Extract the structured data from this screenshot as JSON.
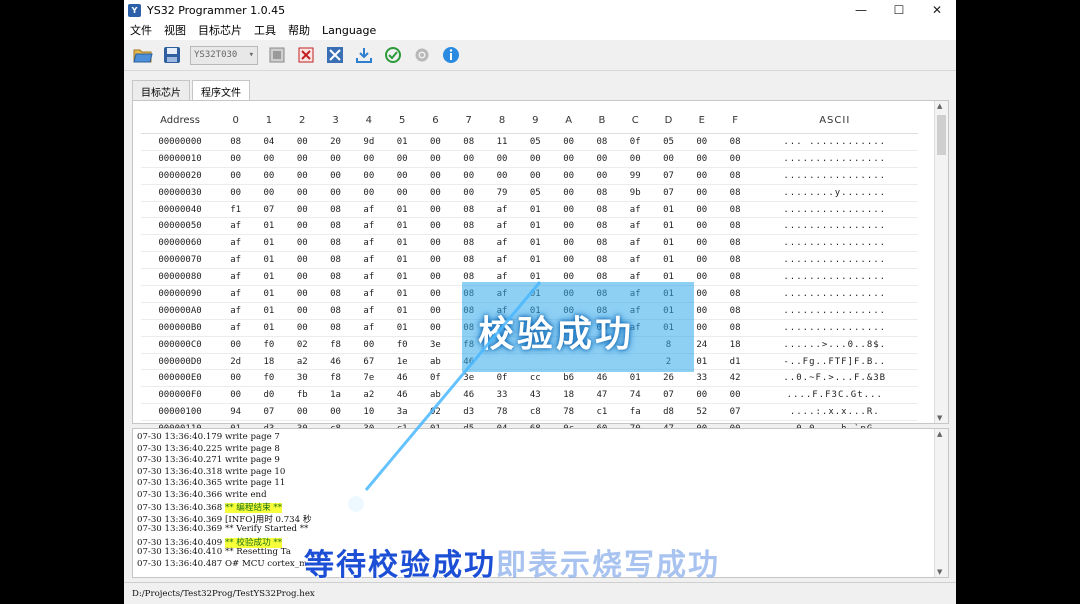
{
  "window": {
    "title": "YS32 Programmer 1.0.45"
  },
  "window_controls": {
    "minimize": "—",
    "maximize": "☐",
    "close": "✕"
  },
  "menu": [
    "文件",
    "视图",
    "目标芯片",
    "工具",
    "帮助",
    "Language"
  ],
  "toolbar": {
    "chip_select": "YS32T030"
  },
  "tabs": [
    "目标芯片",
    "程序文件"
  ],
  "hex_view": {
    "headers": [
      "Address",
      "0",
      "1",
      "2",
      "3",
      "4",
      "5",
      "6",
      "7",
      "8",
      "9",
      "A",
      "B",
      "C",
      "D",
      "E",
      "F",
      "ASCII"
    ],
    "rows": [
      [
        "00000000",
        "08",
        "04",
        "00",
        "20",
        "9d",
        "01",
        "00",
        "08",
        "11",
        "05",
        "00",
        "08",
        "0f",
        "05",
        "00",
        "08",
        "... ............"
      ],
      [
        "00000010",
        "00",
        "00",
        "00",
        "00",
        "00",
        "00",
        "00",
        "00",
        "00",
        "00",
        "00",
        "00",
        "00",
        "00",
        "00",
        "00",
        "................"
      ],
      [
        "00000020",
        "00",
        "00",
        "00",
        "00",
        "00",
        "00",
        "00",
        "00",
        "00",
        "00",
        "00",
        "00",
        "99",
        "07",
        "00",
        "08",
        "................"
      ],
      [
        "00000030",
        "00",
        "00",
        "00",
        "00",
        "00",
        "00",
        "00",
        "00",
        "79",
        "05",
        "00",
        "08",
        "9b",
        "07",
        "00",
        "08",
        "........y......."
      ],
      [
        "00000040",
        "f1",
        "07",
        "00",
        "08",
        "af",
        "01",
        "00",
        "08",
        "af",
        "01",
        "00",
        "08",
        "af",
        "01",
        "00",
        "08",
        "................"
      ],
      [
        "00000050",
        "af",
        "01",
        "00",
        "08",
        "af",
        "01",
        "00",
        "08",
        "af",
        "01",
        "00",
        "08",
        "af",
        "01",
        "00",
        "08",
        "................"
      ],
      [
        "00000060",
        "af",
        "01",
        "00",
        "08",
        "af",
        "01",
        "00",
        "08",
        "af",
        "01",
        "00",
        "08",
        "af",
        "01",
        "00",
        "08",
        "................"
      ],
      [
        "00000070",
        "af",
        "01",
        "00",
        "08",
        "af",
        "01",
        "00",
        "08",
        "af",
        "01",
        "00",
        "08",
        "af",
        "01",
        "00",
        "08",
        "................"
      ],
      [
        "00000080",
        "af",
        "01",
        "00",
        "08",
        "af",
        "01",
        "00",
        "08",
        "af",
        "01",
        "00",
        "08",
        "af",
        "01",
        "00",
        "08",
        "................"
      ],
      [
        "00000090",
        "af",
        "01",
        "00",
        "08",
        "af",
        "01",
        "00",
        "08",
        "af",
        "01",
        "00",
        "08",
        "af",
        "01",
        "00",
        "08",
        "................"
      ],
      [
        "000000A0",
        "af",
        "01",
        "00",
        "08",
        "af",
        "01",
        "00",
        "08",
        "af",
        "01",
        "00",
        "08",
        "af",
        "01",
        "00",
        "08",
        "................"
      ],
      [
        "000000B0",
        "af",
        "01",
        "00",
        "08",
        "af",
        "01",
        "00",
        "08",
        "af",
        "01",
        "00",
        "08",
        "af",
        "01",
        "00",
        "08",
        "................"
      ],
      [
        "000000C0",
        "00",
        "f0",
        "02",
        "f8",
        "00",
        "f0",
        "3e",
        "f8",
        "",
        "",
        "",
        "",
        "",
        "8",
        "24",
        "18",
        "......>...0..8$."
      ],
      [
        "000000D0",
        "2d",
        "18",
        "a2",
        "46",
        "67",
        "1e",
        "ab",
        "46",
        "",
        "",
        "",
        "",
        "",
        "2",
        "01",
        "d1",
        "-..Fg..FTF]F.B.."
      ],
      [
        "000000E0",
        "00",
        "f0",
        "30",
        "f8",
        "7e",
        "46",
        "0f",
        "3e",
        "0f",
        "cc",
        "b6",
        "46",
        "01",
        "26",
        "33",
        "42",
        "..0.~F.>...F.&3B"
      ],
      [
        "000000F0",
        "00",
        "d0",
        "fb",
        "1a",
        "a2",
        "46",
        "ab",
        "46",
        "33",
        "43",
        "18",
        "47",
        "74",
        "07",
        "00",
        "00",
        "....F.F3C.Gt..."
      ],
      [
        "00000100",
        "94",
        "07",
        "00",
        "00",
        "10",
        "3a",
        "02",
        "d3",
        "78",
        "c8",
        "78",
        "c1",
        "fa",
        "d8",
        "52",
        "07",
        "....:.x.x...R."
      ],
      [
        "00000110",
        "01",
        "d3",
        "30",
        "c8",
        "30",
        "c1",
        "01",
        "d5",
        "04",
        "68",
        "0c",
        "60",
        "70",
        "47",
        "00",
        "00",
        "..0.0....h.`pG.."
      ]
    ]
  },
  "log": {
    "lines": [
      {
        "text": "07-30 13:36:40.179 write page 7"
      },
      {
        "text": "07-30 13:36:40.225 write page 8"
      },
      {
        "text": "07-30 13:36:40.271 write page 9"
      },
      {
        "text": "07-30 13:36:40.318 write page 10"
      },
      {
        "text": "07-30 13:36:40.365 write page 11"
      },
      {
        "text": "07-30 13:36:40.366 write end"
      },
      {
        "prefix": "07-30 13:36:40.368 ",
        "highlight": "** 编程结束 **"
      },
      {
        "text": "07-30 13:36:40.369 [INFO]用时 0.734 秒"
      },
      {
        "text": "07-30 13:36:40.369 ** Verify Started **"
      },
      {
        "prefix": "07-30 13:36:40.409 ",
        "highlight": "** 校验成功 **"
      },
      {
        "text": "07-30 13:36:40.410 ** Resetting Ta"
      },
      {
        "text": "07-30 13:36:40.487 O# MCU cortex_m"
      }
    ]
  },
  "status": {
    "path": "D:/Projects/Test32Prog/TestYS32Prog.hex"
  },
  "overlay": {
    "title": "校验成功",
    "caption_main": "等待校验成功",
    "caption_faint": "即表示烧写成功"
  },
  "colors": {
    "overlay_blue": "#32aaeb",
    "caption_blue": "#1c4fd6",
    "highlight_yellow": "#f7ff3a"
  }
}
